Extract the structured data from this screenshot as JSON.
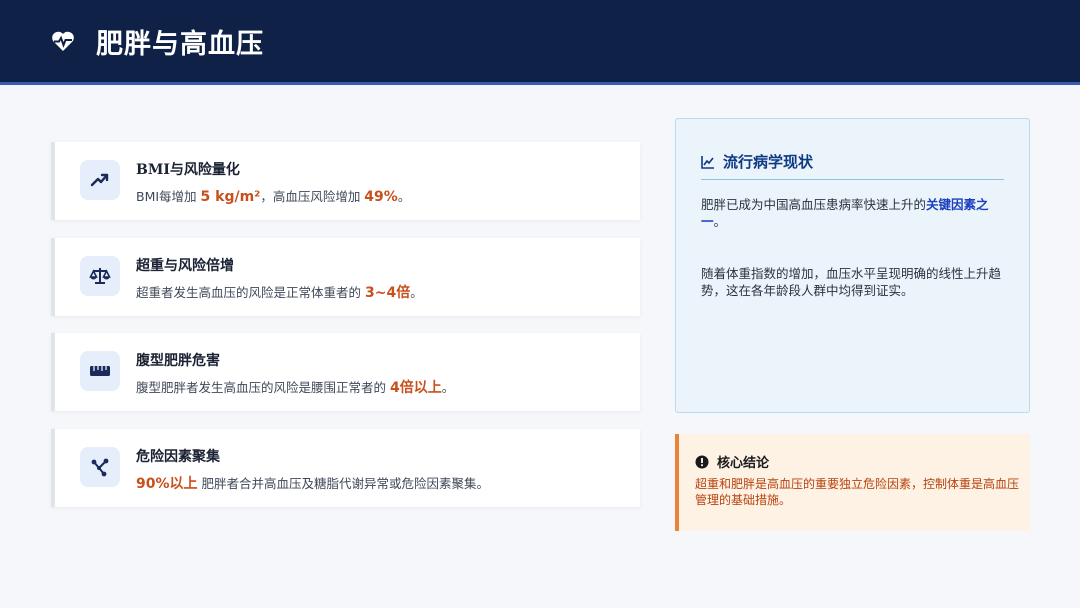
{
  "header": {
    "title": "肥胖与高血压",
    "icon": "heart-pulse-icon"
  },
  "cards": [
    {
      "icon": "trending-up-icon",
      "title": "BMI与风险量化",
      "desc_pre": "BMI每增加 ",
      "desc_hl1": "5 kg/m²",
      "desc_mid": "，高血压风险增加 ",
      "desc_hl2": "49%",
      "desc_post": "。"
    },
    {
      "icon": "scale-icon",
      "title": "超重与风险倍增",
      "desc_pre": "超重者发生高血压的风险是正常体重者的 ",
      "desc_hl": "3~4倍",
      "desc_post": "。"
    },
    {
      "icon": "ruler-icon",
      "title": "腹型肥胖危害",
      "desc_pre": "腹型肥胖者发生高血压的风险是腰围正常者的 ",
      "desc_hl": "4倍以上",
      "desc_post": "。"
    },
    {
      "icon": "cluster-icon",
      "title": "危险因素聚集",
      "desc_hl": "90%以上",
      "desc_post": " 肥胖者合并高血压及糖脂代谢异常或危险因素聚集。"
    }
  ],
  "panel": {
    "icon": "line-chart-icon",
    "title": "流行病学现状",
    "para1_pre": "肥胖已成为中国高血压患病率快速上升的",
    "para1_hl": "关键因素之一",
    "para1_post": "。",
    "para2": "随着体重指数的增加，血压水平呈现明确的线性上升趋势，这在各年龄段人群中均得到证实。"
  },
  "conclusion": {
    "icon": "alert-icon",
    "title": "核心结论",
    "body": "超重和肥胖是高血压的重要独立危险因素，控制体重是高血压管理的基础措施。"
  }
}
